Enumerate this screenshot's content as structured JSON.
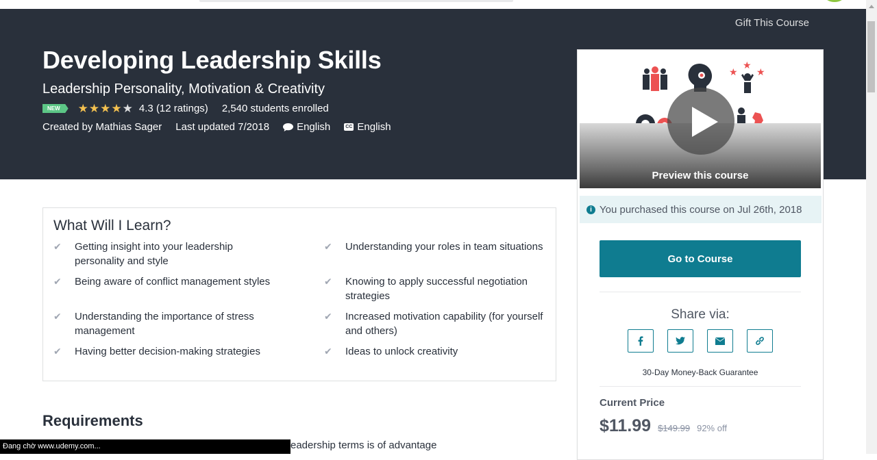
{
  "header": {
    "gift_label": "Gift This Course",
    "title": "Developing Leadership Skills",
    "subtitle": "Leadership Personality, Motivation & Creativity",
    "badge": "NEW",
    "rating_text": "4.3 (12 ratings)",
    "rating_value": 4.3,
    "students": "2,540 students enrolled",
    "created_by": "Created by Mathias Sager",
    "last_updated": "Last updated 7/2018",
    "language": "English",
    "captions": "English",
    "captions_badge": "CC"
  },
  "learn": {
    "heading": "What Will I Learn?",
    "items": [
      "Getting insight into your leadership personality and style",
      "Understanding your roles in team situations",
      "Being aware of conflict management styles",
      "Knowing to apply successful negotiation strategies",
      "Understanding the importance of stress management",
      "Increased motivation capability (for yourself and others)",
      "Having better decision-making strategies",
      "Ideas to unlock creativity"
    ]
  },
  "requirements": {
    "heading": "Requirements",
    "partial_text": "eadership terms is of advantage"
  },
  "status_bar": "Đang chờ www.udemy.com...",
  "card": {
    "preview_label": "Preview this course",
    "purchased": "You purchased this course on Jul 26th, 2018",
    "goto_label": "Go to Course",
    "share_label": "Share via:",
    "share_icons": [
      "facebook-icon",
      "twitter-icon",
      "envelope-icon",
      "link-icon"
    ],
    "guarantee": "30-Day Money-Back Guarantee",
    "current_price_label": "Current Price",
    "price": "$11.99",
    "original_price": "$149.99",
    "discount": "92% off"
  },
  "colors": {
    "hero_bg": "#29303b",
    "accent": "#0f7c90",
    "star": "#f4c150",
    "badge_new": "#5cc686",
    "icon_red": "#ec5252"
  }
}
